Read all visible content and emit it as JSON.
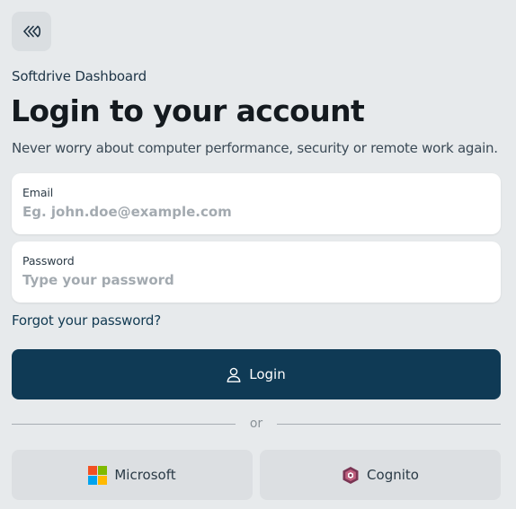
{
  "app": {
    "logo_icon": "softdrive-logo-icon",
    "brand_name": "Softdrive Dashboard"
  },
  "heading": {
    "title": "Login to your account",
    "subtitle": "Never worry about computer performance, security or remote work again."
  },
  "form": {
    "email": {
      "label": "Email",
      "value": "",
      "placeholder": "Eg. john.doe@example.com"
    },
    "password": {
      "label": "Password",
      "value": "",
      "placeholder": "Type your password"
    },
    "forgot_label": "Forgot your password?",
    "login_label": "Login",
    "login_icon": "user-icon"
  },
  "divider_label": "or",
  "sso": {
    "microsoft": {
      "label": "Microsoft",
      "icon": "microsoft-logo-icon"
    },
    "cognito": {
      "label": "Cognito",
      "icon": "cognito-logo-icon"
    }
  },
  "colors": {
    "page_background": "#e7eaec",
    "primary_button": "#0f3a55",
    "secondary_button": "#dcdfe2",
    "link": "#123a52"
  }
}
